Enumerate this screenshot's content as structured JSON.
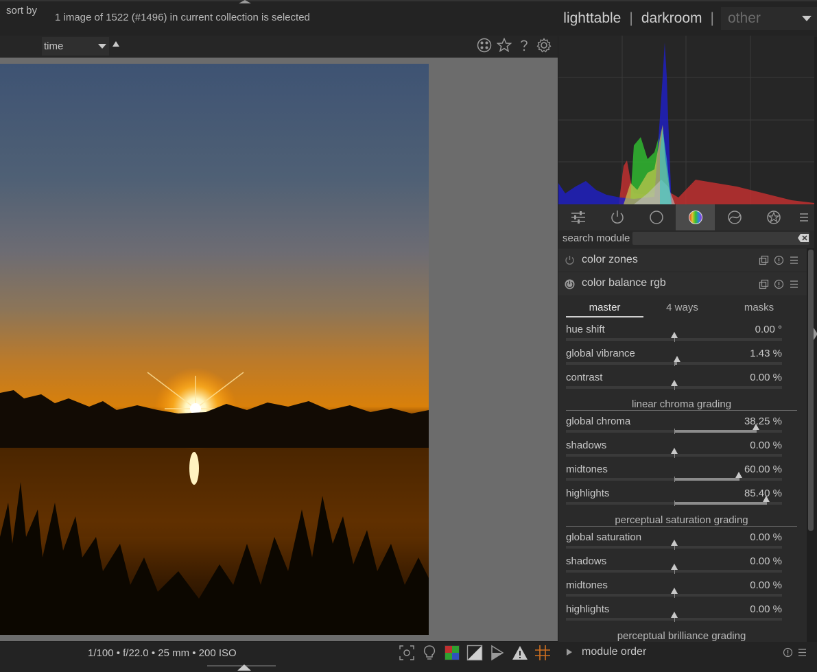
{
  "topbar": {
    "selection_info": "1 image of 1522 (#1496) in current collection is selected",
    "views": {
      "lighttable": "lighttable",
      "separator": "|",
      "darkroom": "darkroom",
      "other": "other"
    }
  },
  "center_header": {
    "sort_label": "sort by",
    "sort_value": "time",
    "icons": [
      "grouping-icon",
      "star-icon",
      "help-icon",
      "gear-icon"
    ]
  },
  "image": {
    "exif": "1/100 • f/22.0 • 25 mm • 200 ISO"
  },
  "bottom_icons": [
    "focus-peaking-icon",
    "color-assessment-icon",
    "raw-overexposed-icon",
    "clipping-icon",
    "softproof-icon",
    "gamut-check-icon",
    "guides-icon"
  ],
  "module_groups": {
    "items": [
      "quick-access-icon",
      "active-modules-icon",
      "base-modules-icon",
      "color-modules-icon",
      "correct-modules-icon",
      "effects-modules-icon",
      "presets-menu-icon"
    ],
    "active_index": 3
  },
  "search": {
    "label": "search module",
    "value": ""
  },
  "modules": {
    "color_zones": {
      "title": "color zones"
    },
    "color_balance_rgb": {
      "title": "color balance rgb",
      "tabs": [
        "master",
        "4 ways",
        "masks"
      ],
      "active_tab": 0,
      "sliders_group1": [
        {
          "label": "hue shift",
          "value": "0.00 °",
          "position": 0.5,
          "fill_from": 0.5
        },
        {
          "label": "global vibrance",
          "value": "1.43 %",
          "position": 0.513,
          "fill_from": 0.5
        },
        {
          "label": "contrast",
          "value": "0.00 %",
          "position": 0.5,
          "fill_from": 0.5
        }
      ],
      "section_linear": "linear chroma grading",
      "sliders_group2": [
        {
          "label": "global chroma",
          "value": "38.25 %",
          "position": 0.88,
          "fill_from": 0.5
        },
        {
          "label": "shadows",
          "value": "0.00 %",
          "position": 0.5,
          "fill_from": 0.5
        },
        {
          "label": "midtones",
          "value": "60.00 %",
          "position": 0.8,
          "fill_from": 0.5
        },
        {
          "label": "highlights",
          "value": "85.40 %",
          "position": 0.927,
          "fill_from": 0.5
        }
      ],
      "section_perceptual": "perceptual saturation grading",
      "sliders_group3": [
        {
          "label": "global saturation",
          "value": "0.00 %",
          "position": 0.5,
          "fill_from": 0.5
        },
        {
          "label": "shadows",
          "value": "0.00 %",
          "position": 0.5,
          "fill_from": 0.5
        },
        {
          "label": "midtones",
          "value": "0.00 %",
          "position": 0.5,
          "fill_from": 0.5
        },
        {
          "label": "highlights",
          "value": "0.00 %",
          "position": 0.5,
          "fill_from": 0.5
        }
      ],
      "section_brilliance": "perceptual brilliance grading"
    },
    "module_order": {
      "title": "module order"
    }
  },
  "colors": {
    "accent_fill": "#8c8c8c",
    "panel_bg": "#2a2a2a",
    "image_bg": "#6c6c6c"
  }
}
